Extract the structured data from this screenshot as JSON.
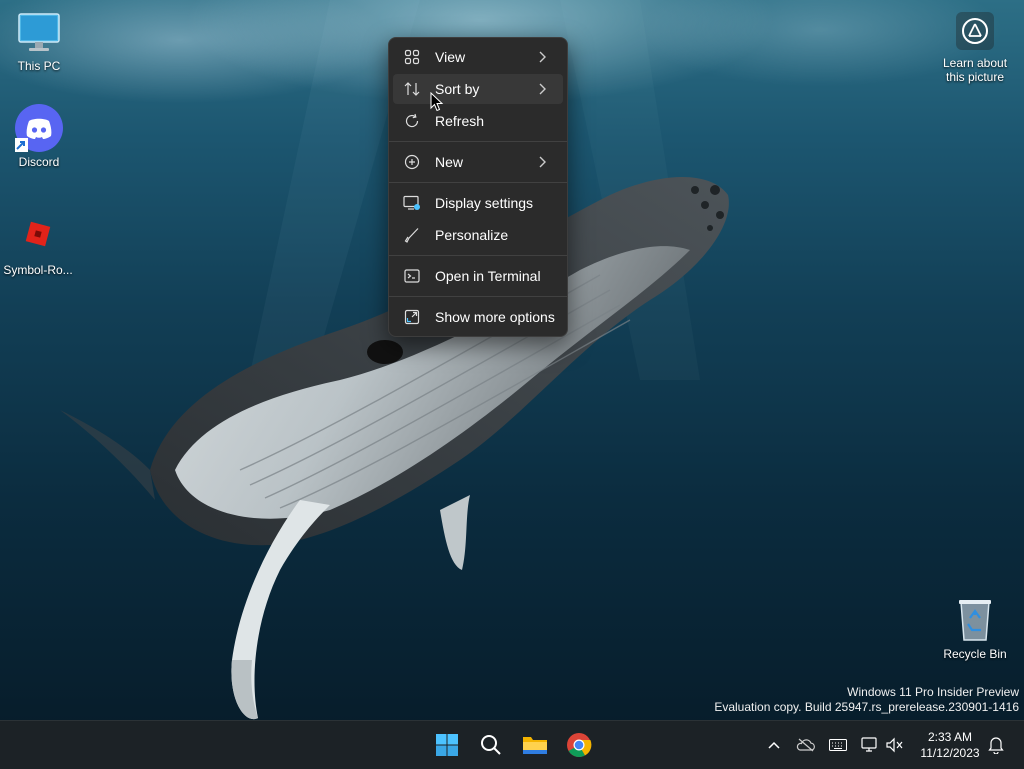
{
  "desktop": {
    "icons": [
      {
        "label": "This PC",
        "icon": "monitor-icon"
      },
      {
        "label": "Discord",
        "icon": "discord-icon"
      },
      {
        "label": "Symbol-Ro...",
        "icon": "roblox-icon"
      },
      {
        "label": "Recycle Bin",
        "icon": "recycle-bin-icon"
      }
    ],
    "learn_about": {
      "line1": "Learn about",
      "line2": "this picture"
    },
    "watermark": {
      "line1": "Windows 11 Pro Insider Preview",
      "line2": "Evaluation copy. Build 25947.rs_prerelease.230901-1416"
    }
  },
  "context_menu": {
    "items": [
      {
        "label": "View",
        "icon": "grid-icon",
        "submenu": true
      },
      {
        "label": "Sort by",
        "icon": "sort-icon",
        "submenu": true
      },
      {
        "label": "Refresh",
        "icon": "refresh-icon",
        "submenu": false
      },
      {
        "label": "New",
        "icon": "plus-circle-icon",
        "submenu": true
      },
      {
        "label": "Display settings",
        "icon": "display-icon",
        "submenu": false
      },
      {
        "label": "Personalize",
        "icon": "brush-icon",
        "submenu": false
      },
      {
        "label": "Open in Terminal",
        "icon": "terminal-icon",
        "submenu": false
      },
      {
        "label": "Show more options",
        "icon": "expand-icon",
        "submenu": false
      }
    ]
  },
  "taskbar": {
    "apps": [
      "start-icon",
      "search-icon",
      "file-explorer-icon",
      "chrome-icon"
    ],
    "tray": [
      "chevron-up-icon",
      "onedrive-icon",
      "keyboard-icon",
      "network-icon",
      "volume-muted-icon"
    ],
    "clock": {
      "time": "2:33 AM",
      "date": "11/12/2023"
    },
    "notification": "bell-icon"
  },
  "colors": {
    "menu_bg": "#2b2b2b",
    "taskbar_bg": "#1c2226",
    "accent": "#4cc2ff"
  }
}
